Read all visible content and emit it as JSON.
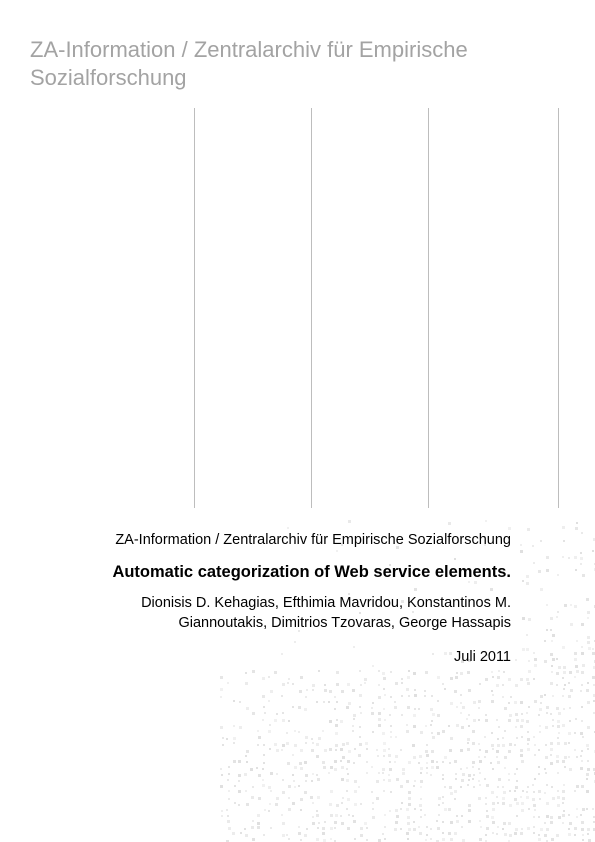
{
  "header": {
    "title": "ZA-Information / Zentralarchiv für Empirische Sozialforschung"
  },
  "publication": {
    "publisher": "ZA-Information / Zentralarchiv für Empirische Sozialforschung",
    "title": "Automatic categorization of Web service elements.",
    "authors_line1": "Dionisis D. Kehagias, Efthimia Mavridou, Konstantinos M.",
    "authors_line2": "Giannoutakis, Dimitrios Tzovaras, George Hassapis",
    "date": "Juli 2011"
  },
  "colors": {
    "header_text": "#a3a3a3",
    "rules": "#bdbdbd",
    "dot_pattern": "#d9d9d9"
  }
}
